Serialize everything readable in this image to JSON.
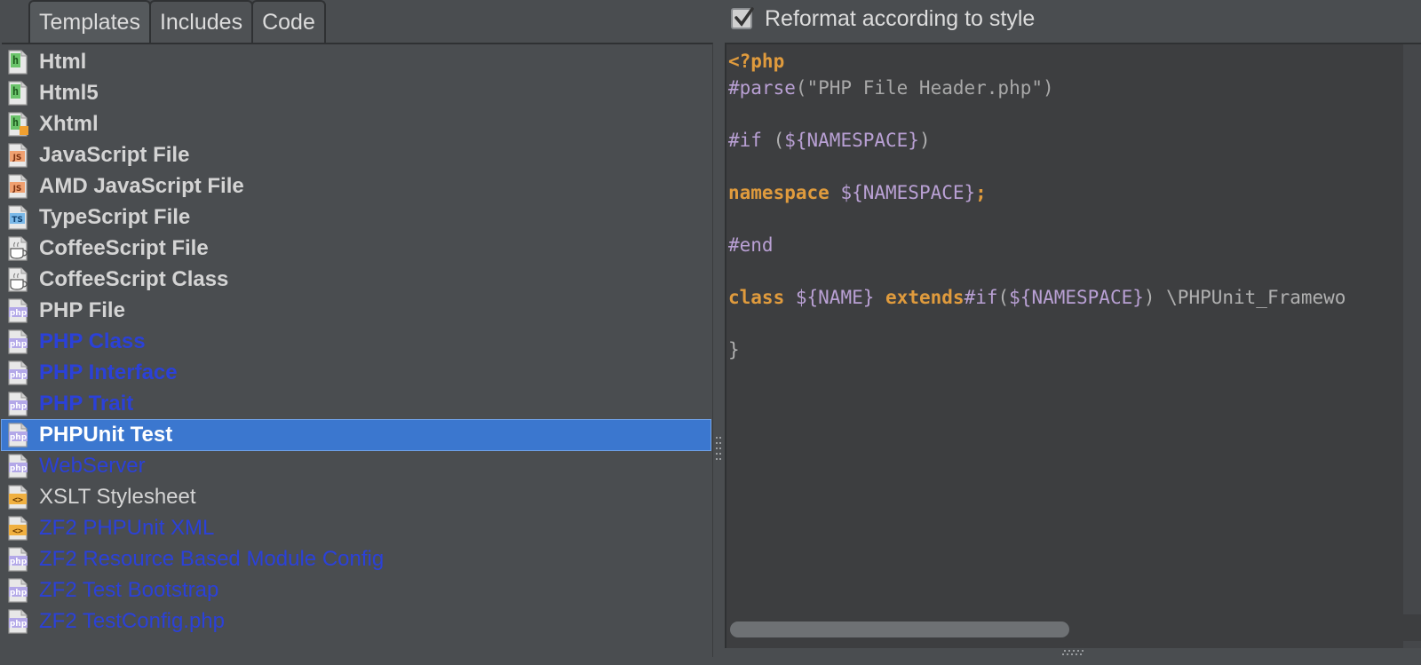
{
  "tabs": [
    "Templates",
    "Includes",
    "Code"
  ],
  "active_tab": 0,
  "templates": [
    {
      "label": "Html",
      "icon": "html",
      "style": "normal-bold"
    },
    {
      "label": "Html5",
      "icon": "html",
      "style": "normal-bold"
    },
    {
      "label": "Xhtml",
      "icon": "xhtml",
      "style": "normal-bold"
    },
    {
      "label": "JavaScript File",
      "icon": "js",
      "style": "normal-bold"
    },
    {
      "label": "AMD JavaScript File",
      "icon": "js",
      "style": "normal-bold"
    },
    {
      "label": "TypeScript File",
      "icon": "ts",
      "style": "normal-bold"
    },
    {
      "label": "CoffeeScript File",
      "icon": "coffee",
      "style": "normal-bold"
    },
    {
      "label": "CoffeeScript Class",
      "icon": "coffee",
      "style": "normal-bold"
    },
    {
      "label": "PHP File",
      "icon": "php",
      "style": "normal-bold"
    },
    {
      "label": "PHP Class",
      "icon": "php",
      "style": "blue-bold"
    },
    {
      "label": "PHP Interface",
      "icon": "php",
      "style": "blue-bold"
    },
    {
      "label": "PHP Trait",
      "icon": "php",
      "style": "blue-bold"
    },
    {
      "label": "PHPUnit Test",
      "icon": "php",
      "style": "selected"
    },
    {
      "label": "WebServer",
      "icon": "php",
      "style": "blue"
    },
    {
      "label": "XSLT Stylesheet",
      "icon": "xml",
      "style": "normal"
    },
    {
      "label": "ZF2 PHPUnit XML",
      "icon": "xml",
      "style": "blue"
    },
    {
      "label": "ZF2 Resource Based Module Config",
      "icon": "php",
      "style": "blue"
    },
    {
      "label": "ZF2 Test Bootstrap",
      "icon": "php",
      "style": "blue"
    },
    {
      "label": "ZF2 TestConfig.php",
      "icon": "php",
      "style": "blue"
    }
  ],
  "reformat": {
    "label": "Reformat according to style",
    "checked": true
  },
  "code_lines": [
    [
      {
        "t": "<?php",
        "c": "kw"
      }
    ],
    [
      {
        "t": "#parse",
        "c": "dir"
      },
      {
        "t": "(\"PHP File Header.php\")",
        "c": "str"
      }
    ],
    [],
    [
      {
        "t": "#if",
        "c": "dir"
      },
      {
        "t": " (",
        "c": "plain"
      },
      {
        "t": "${NAMESPACE}",
        "c": "dir"
      },
      {
        "t": ")",
        "c": "plain"
      }
    ],
    [],
    [
      {
        "t": "namespace",
        "c": "kw"
      },
      {
        "t": " ",
        "c": "plain"
      },
      {
        "t": "${NAMESPACE}",
        "c": "dir"
      },
      {
        "t": ";",
        "c": "kw"
      }
    ],
    [],
    [
      {
        "t": "#end",
        "c": "dir"
      }
    ],
    [],
    [
      {
        "t": "class",
        "c": "kw"
      },
      {
        "t": " ",
        "c": "plain"
      },
      {
        "t": "${NAME}",
        "c": "dir"
      },
      {
        "t": " ",
        "c": "plain"
      },
      {
        "t": "extends",
        "c": "kw"
      },
      {
        "t": "#if",
        "c": "dir"
      },
      {
        "t": "(",
        "c": "plain"
      },
      {
        "t": "${NAMESPACE}",
        "c": "dir"
      },
      {
        "t": ") \\PHPUnit_Framewo",
        "c": "plain"
      }
    ],
    [],
    [
      {
        "t": "}",
        "c": "plain"
      }
    ]
  ],
  "colors": {
    "selection": "#3b77cf",
    "blue_label": "#2b41d8",
    "keyword": "#e09b3d",
    "directive": "#b9a0d4"
  }
}
